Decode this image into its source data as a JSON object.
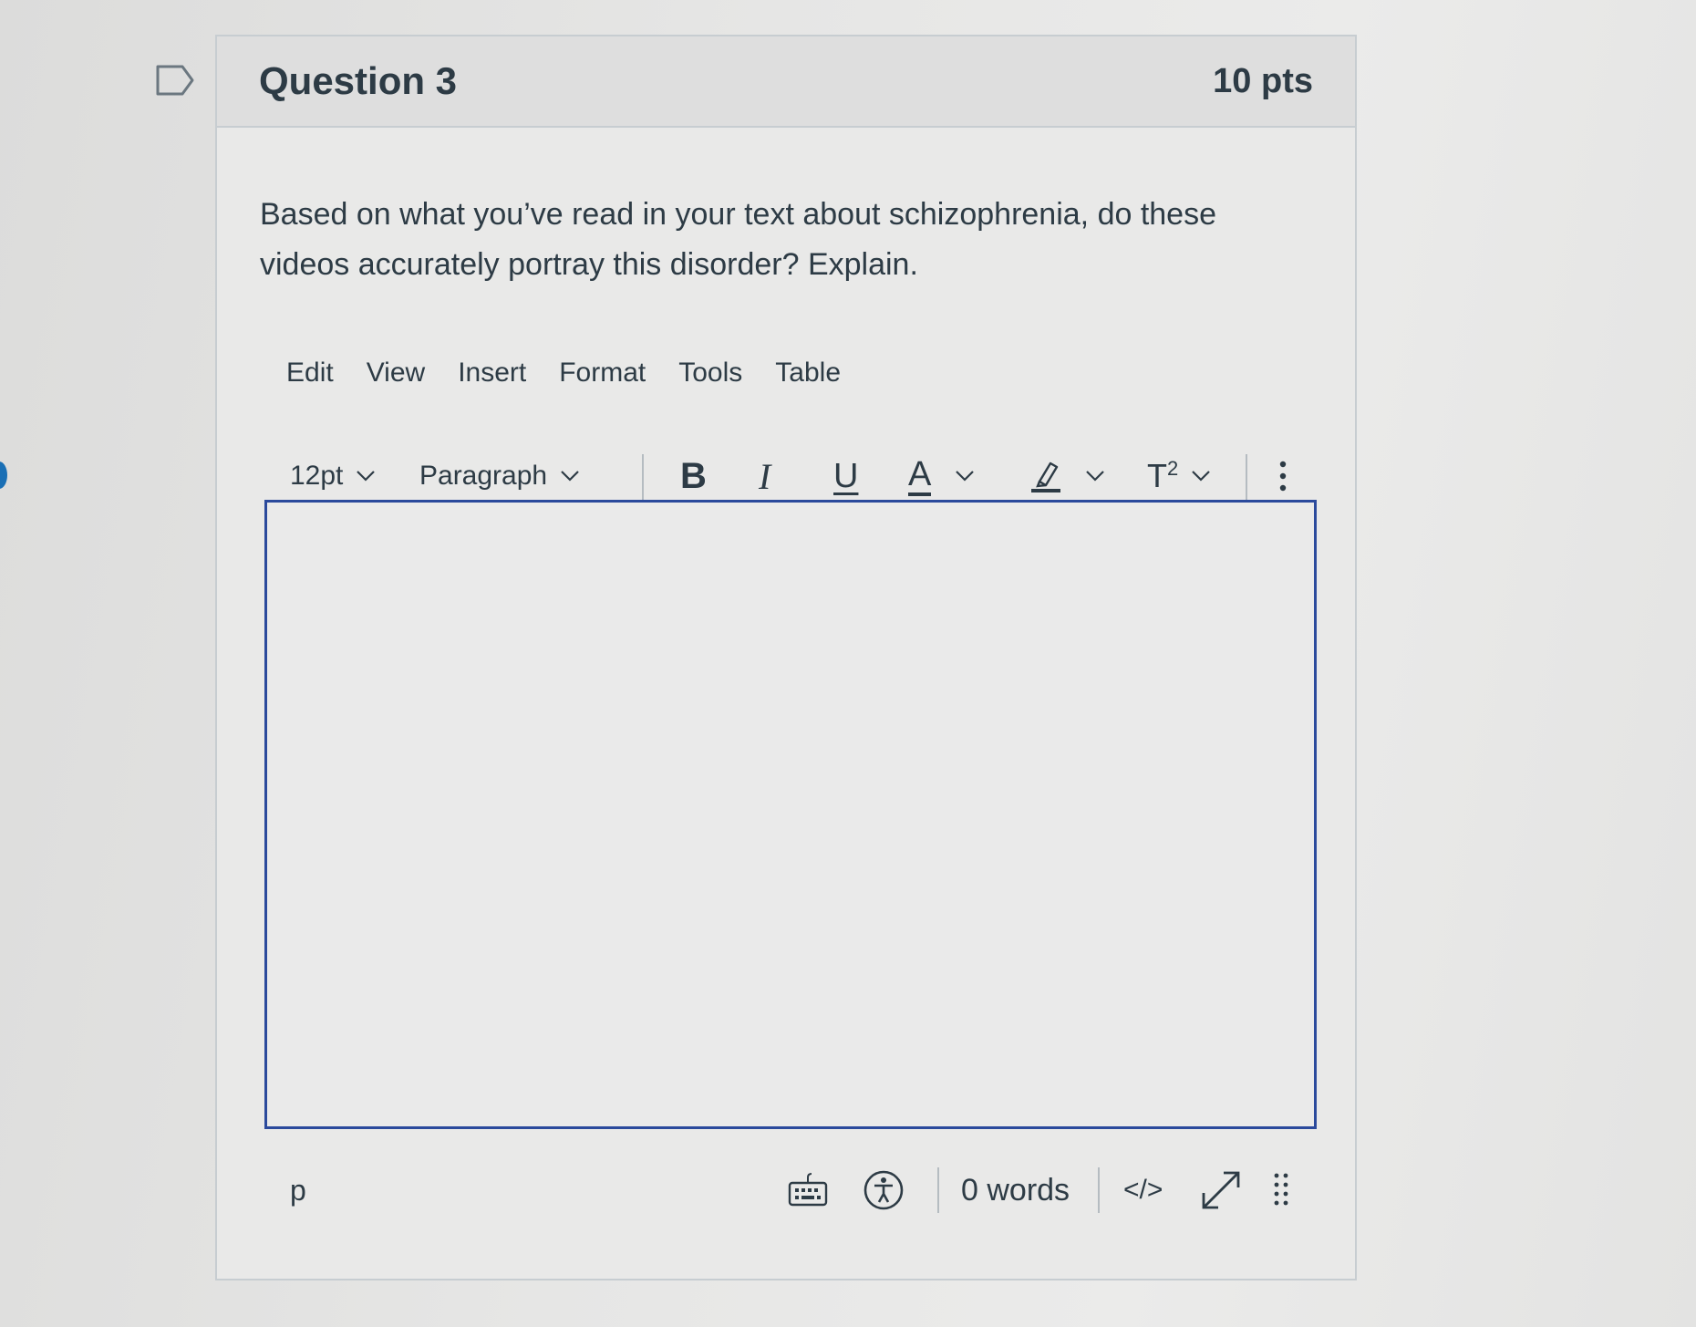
{
  "question": {
    "title": "Question 3",
    "points": "10 pts",
    "text": "Based on what you’ve read in your text about schizophrenia, do these videos accurately portray this disorder? Explain."
  },
  "menu": [
    "Edit",
    "View",
    "Insert",
    "Format",
    "Tools",
    "Table"
  ],
  "toolbar": {
    "font_size": "12pt",
    "block_format": "Paragraph",
    "bold": "B",
    "italic": "I",
    "underline": "U",
    "text_color": "A",
    "superscript": "T",
    "superscript_exp": "2"
  },
  "editor": {
    "content": ""
  },
  "status": {
    "element_path": "p",
    "word_count": "0 words",
    "html_editor": "</>"
  },
  "icons": {
    "flag": "flag-icon",
    "keyboard": "keyboard-icon",
    "accessibility": "accessibility-icon",
    "fullscreen": "expand-icon",
    "resize": "resize-grip-icon",
    "more": "more-vertical-icon"
  },
  "colors": {
    "accent": "#2b4a9c",
    "text": "#2d3b45"
  }
}
